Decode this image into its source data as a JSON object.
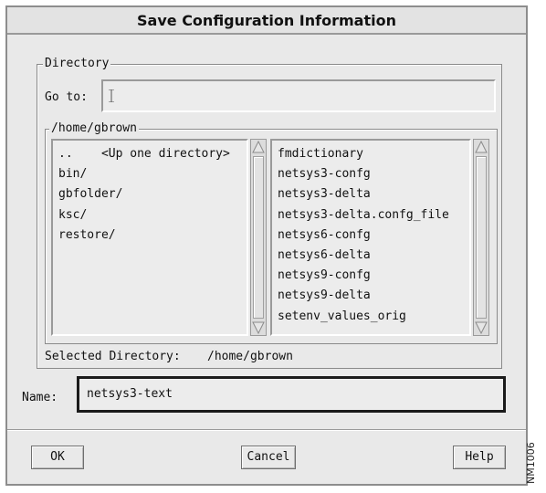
{
  "dialog": {
    "title": "Save Configuration Information"
  },
  "directory": {
    "legend": "Directory",
    "goto_label": "Go to:",
    "goto_value": "",
    "path_legend": "/home/gbrown",
    "folders": [
      "..    <Up one directory>",
      "bin/",
      "gbfolder/",
      "ksc/",
      "restore/"
    ],
    "files": [
      "fmdictionary",
      "netsys3-confg",
      "netsys3-delta",
      "netsys3-delta.confg_file",
      "netsys6-confg",
      "netsys6-delta",
      "netsys9-confg",
      "netsys9-delta",
      "setenv_values_orig"
    ],
    "selected_label": "Selected Directory:",
    "selected_value": "/home/gbrown"
  },
  "name": {
    "label": "Name:",
    "value": "netsys3-text"
  },
  "buttons": {
    "ok": "OK",
    "cancel": "Cancel",
    "help": "Help"
  },
  "figure_tag": "NM1006"
}
